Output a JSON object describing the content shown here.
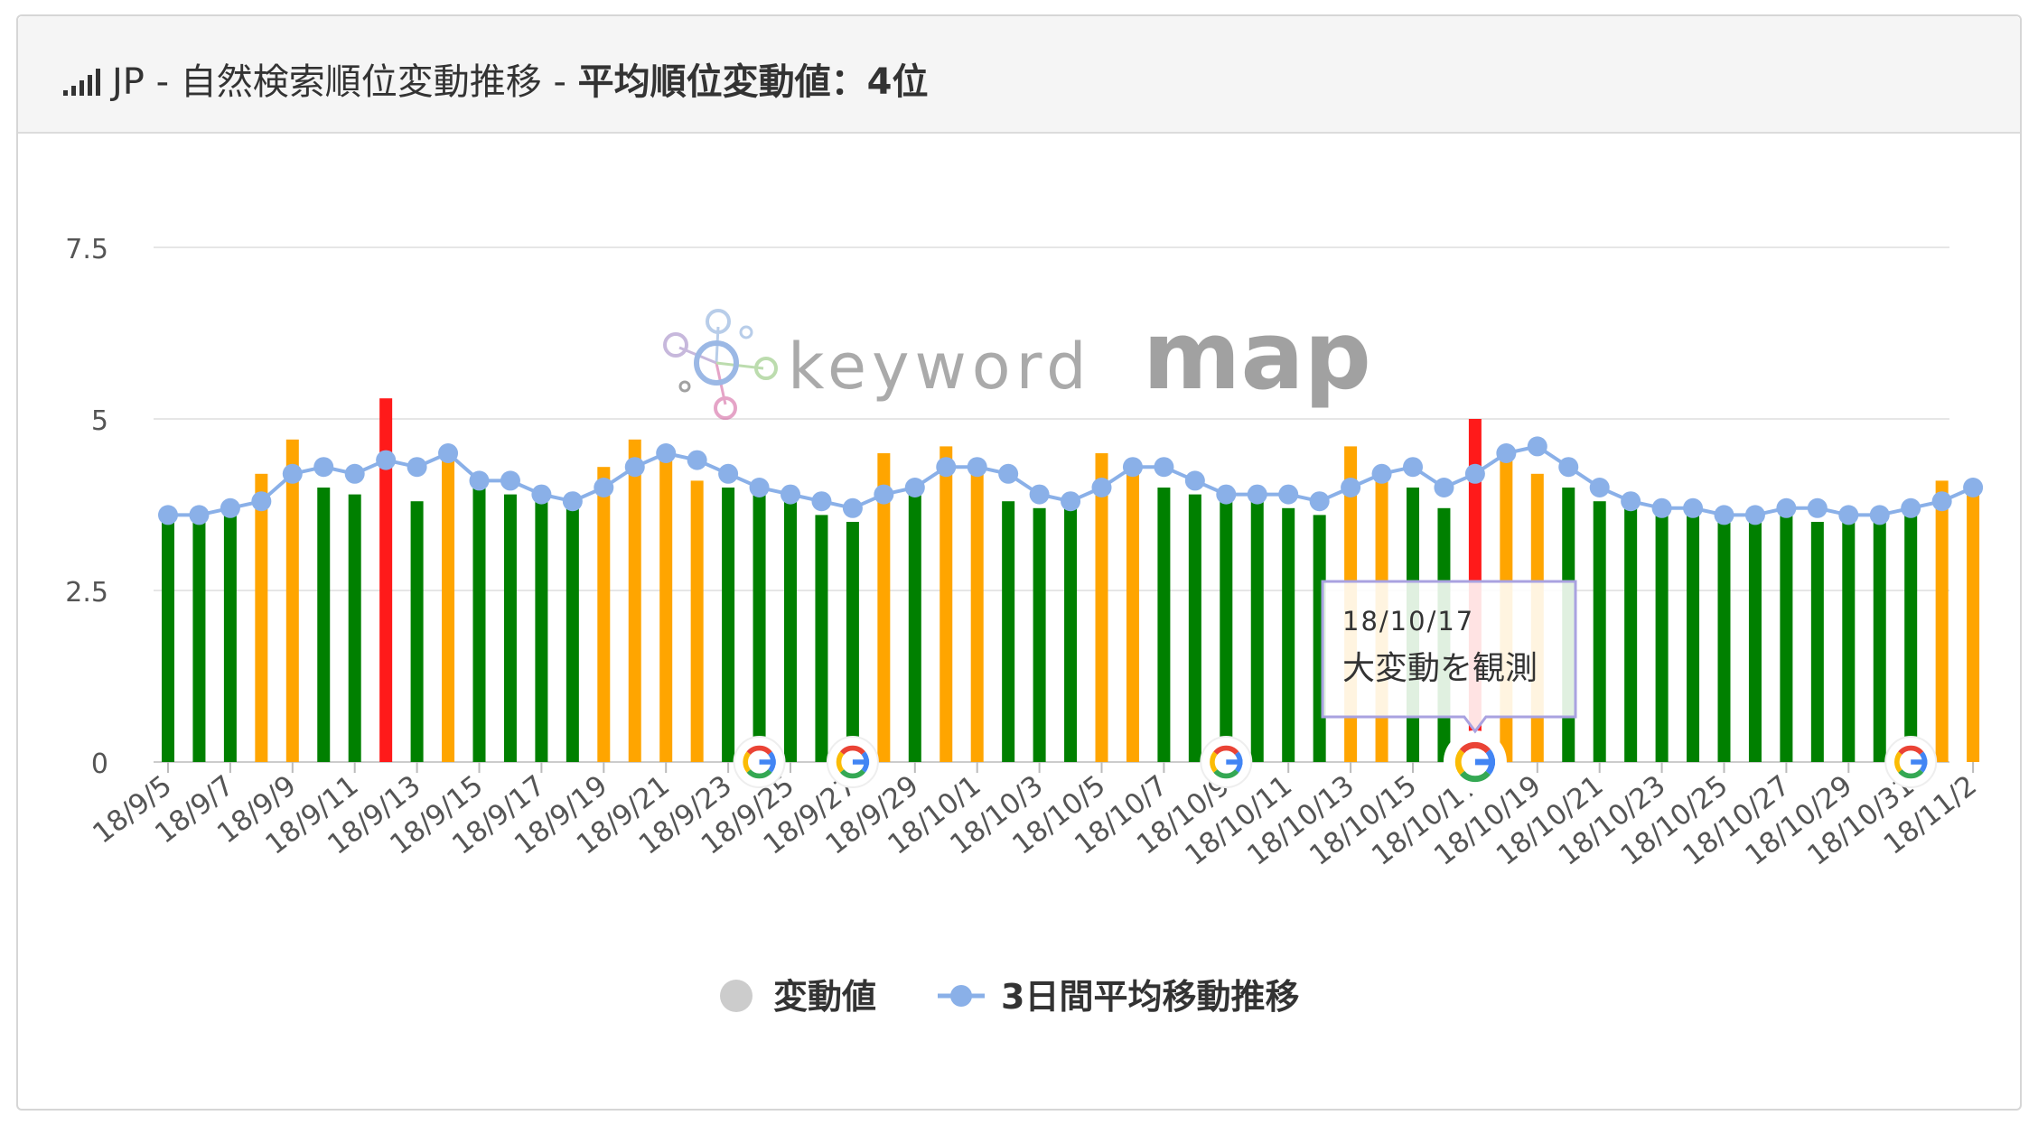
{
  "header": {
    "prefix": "JP - 自然検索順位変動推移 - ",
    "metric_label": "平均順位変動値：",
    "metric_value": "4位",
    "icon": "signal-bars-icon"
  },
  "watermark": {
    "text_light": "keyword",
    "text_bold": "map"
  },
  "legend": {
    "bar_label": "変動値",
    "line_label": "3日間平均移動推移"
  },
  "tooltip": {
    "date": "18/10/17",
    "text": "大変動を観測"
  },
  "colors": {
    "green": "#008000",
    "orange": "#ffa500",
    "red": "#ff1a1a",
    "line": "#8ab0e8",
    "grid": "#e6e6e6"
  },
  "chart_data": {
    "type": "bar",
    "ylim": [
      0,
      7.5
    ],
    "yticks": [
      "0",
      "2.5",
      "5",
      "7.5"
    ],
    "categories": [
      "18/9/5",
      "18/9/6",
      "18/9/7",
      "18/9/8",
      "18/9/9",
      "18/9/10",
      "18/9/11",
      "18/9/12",
      "18/9/13",
      "18/9/14",
      "18/9/15",
      "18/9/16",
      "18/9/17",
      "18/9/18",
      "18/9/19",
      "18/9/20",
      "18/9/21",
      "18/9/22",
      "18/9/23",
      "18/9/24",
      "18/9/25",
      "18/9/26",
      "18/9/27",
      "18/9/28",
      "18/9/29",
      "18/9/30",
      "18/10/1",
      "18/10/2",
      "18/10/3",
      "18/10/4",
      "18/10/5",
      "18/10/6",
      "18/10/7",
      "18/10/8",
      "18/10/9",
      "18/10/10",
      "18/10/11",
      "18/10/12",
      "18/10/13",
      "18/10/14",
      "18/10/15",
      "18/10/16",
      "18/10/17",
      "18/10/18",
      "18/10/19",
      "18/10/20",
      "18/10/21",
      "18/10/22",
      "18/10/23",
      "18/10/24",
      "18/10/25",
      "18/10/26",
      "18/10/27",
      "18/10/28",
      "18/10/29",
      "18/10/30",
      "18/10/31",
      "18/11/1",
      "18/11/2"
    ],
    "x_tick_labels": [
      "18/9/5",
      "18/9/7",
      "18/9/9",
      "18/9/11",
      "18/9/13",
      "18/9/15",
      "18/9/17",
      "18/9/19",
      "18/9/21",
      "18/9/23",
      "18/9/25",
      "18/9/27",
      "18/9/29",
      "18/10/1",
      "18/10/3",
      "18/10/5",
      "18/10/7",
      "18/10/9",
      "18/10/11",
      "18/10/13",
      "18/10/15",
      "18/10/17",
      "18/10/19",
      "18/10/21",
      "18/10/23",
      "18/10/25",
      "18/10/27",
      "18/10/29",
      "18/10/31",
      "18/11/2"
    ],
    "series": [
      {
        "name": "変動値",
        "type": "bar",
        "values": [
          3.5,
          3.5,
          3.6,
          4.2,
          4.7,
          4.0,
          3.9,
          5.3,
          3.8,
          4.4,
          4.0,
          3.9,
          3.8,
          3.7,
          4.3,
          4.7,
          4.5,
          4.1,
          4.0,
          3.9,
          3.8,
          3.6,
          3.5,
          4.5,
          4.0,
          4.6,
          4.4,
          3.8,
          3.7,
          3.7,
          4.5,
          4.3,
          4.0,
          3.9,
          3.8,
          3.9,
          3.7,
          3.6,
          4.6,
          4.2,
          4.0,
          3.7,
          5.0,
          4.6,
          4.2,
          4.0,
          3.8,
          3.7,
          3.6,
          3.6,
          3.5,
          3.5,
          3.6,
          3.5,
          3.5,
          3.5,
          3.6,
          4.1,
          4.1
        ],
        "colors": [
          "green",
          "green",
          "green",
          "orange",
          "orange",
          "green",
          "green",
          "red",
          "green",
          "orange",
          "green",
          "green",
          "green",
          "green",
          "orange",
          "orange",
          "orange",
          "orange",
          "green",
          "green",
          "green",
          "green",
          "green",
          "orange",
          "green",
          "orange",
          "orange",
          "green",
          "green",
          "green",
          "orange",
          "orange",
          "green",
          "green",
          "green",
          "green",
          "green",
          "green",
          "orange",
          "orange",
          "green",
          "green",
          "red",
          "orange",
          "orange",
          "green",
          "green",
          "green",
          "green",
          "green",
          "green",
          "green",
          "green",
          "green",
          "green",
          "green",
          "green",
          "orange",
          "orange"
        ]
      },
      {
        "name": "3日間平均移動推移",
        "type": "line",
        "values": [
          3.6,
          3.6,
          3.7,
          3.8,
          4.2,
          4.3,
          4.2,
          4.4,
          4.3,
          4.5,
          4.1,
          4.1,
          3.9,
          3.8,
          4.0,
          4.3,
          4.5,
          4.4,
          4.2,
          4.0,
          3.9,
          3.8,
          3.7,
          3.9,
          4.0,
          4.3,
          4.3,
          4.2,
          3.9,
          3.8,
          4.0,
          4.3,
          4.3,
          4.1,
          3.9,
          3.9,
          3.9,
          3.8,
          4.0,
          4.2,
          4.3,
          4.0,
          4.2,
          4.5,
          4.6,
          4.3,
          4.0,
          3.8,
          3.7,
          3.7,
          3.6,
          3.6,
          3.7,
          3.7,
          3.6,
          3.6,
          3.7,
          3.8,
          4.0
        ]
      }
    ],
    "google_update_dates": [
      "18/9/24",
      "18/9/27",
      "18/10/9",
      "18/10/17",
      "18/10/31"
    ]
  }
}
